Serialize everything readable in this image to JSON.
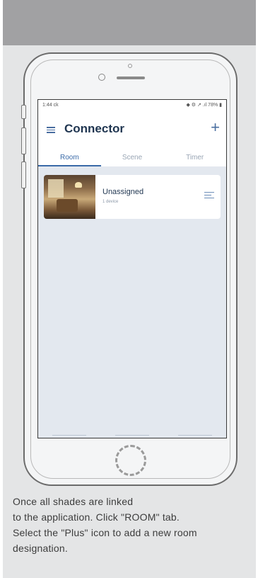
{
  "status_bar": {
    "time": "1:44 ck",
    "indicators": "◆ ⚙ ↗ .ıl 78% ▮"
  },
  "app": {
    "title": "Connector",
    "menu_icon": "hamburger-icon",
    "add_icon": "plus-icon",
    "add_glyph": "+"
  },
  "tabs": [
    {
      "label": "Room",
      "active": true
    },
    {
      "label": "Scene",
      "active": false
    },
    {
      "label": "Timer",
      "active": false
    }
  ],
  "rooms": [
    {
      "name": "Unassigned",
      "count": "1 device",
      "icon": "shade-control-icon"
    }
  ],
  "caption": {
    "line1": "Once all shades are linked",
    "line2": "to the application. Click \"ROOM\"   tab.",
    "line3": "Select the \"Plus\" icon to add a new room",
    "line4": "designation."
  },
  "colors": {
    "brand": "#1f3550",
    "accent": "#3a6aa8",
    "screen_bg": "#e3e8ef",
    "panel_bg": "#e4e5e6"
  }
}
